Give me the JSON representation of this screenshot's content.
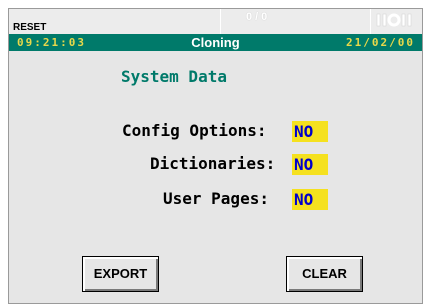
{
  "header": {
    "reset_label": "RESET",
    "counter": "0/0",
    "time": "09:21:03",
    "title": "Cloning",
    "date": "21/02/00"
  },
  "main": {
    "heading": "System Data",
    "rows": [
      {
        "label": "Config Options:",
        "value": "NO"
      },
      {
        "label": "Dictionaries:",
        "value": "NO"
      },
      {
        "label": "User Pages:",
        "value": "NO"
      }
    ]
  },
  "buttons": {
    "export_label": "EXPORT",
    "clear_label": "CLEAR"
  },
  "colors": {
    "title_bar": "#007a6a",
    "header_digits": "#e8d84a",
    "value_bg": "#f5e11f",
    "value_text": "#0000cc",
    "heading_text": "#007a6a"
  },
  "icons": {
    "status": "signal-status-icon"
  }
}
